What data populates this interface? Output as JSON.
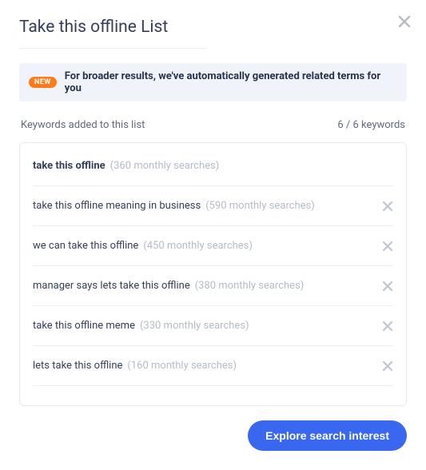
{
  "title": "Take this offline List",
  "banner": {
    "badge": "NEW",
    "text": "For broader results, we've automatically generated related terms for you"
  },
  "list_header": {
    "label": "Keywords added to this list",
    "count": "6 / 6 keywords"
  },
  "keywords": [
    {
      "term": "take this offline",
      "meta": "(360 monthly searches)",
      "bold": true,
      "removable": false
    },
    {
      "term": "take this offline meaning in business",
      "meta": "(590 monthly searches)",
      "bold": false,
      "removable": true
    },
    {
      "term": "we can take this offline",
      "meta": "(450 monthly searches)",
      "bold": false,
      "removable": true
    },
    {
      "term": "manager says lets take this offline",
      "meta": "(380 monthly searches)",
      "bold": false,
      "removable": true
    },
    {
      "term": "take this offline meme",
      "meta": "(330 monthly searches)",
      "bold": false,
      "removable": true
    },
    {
      "term": "lets take this offline",
      "meta": "(160 monthly searches)",
      "bold": false,
      "removable": true
    }
  ],
  "cta_label": "Explore search interest"
}
